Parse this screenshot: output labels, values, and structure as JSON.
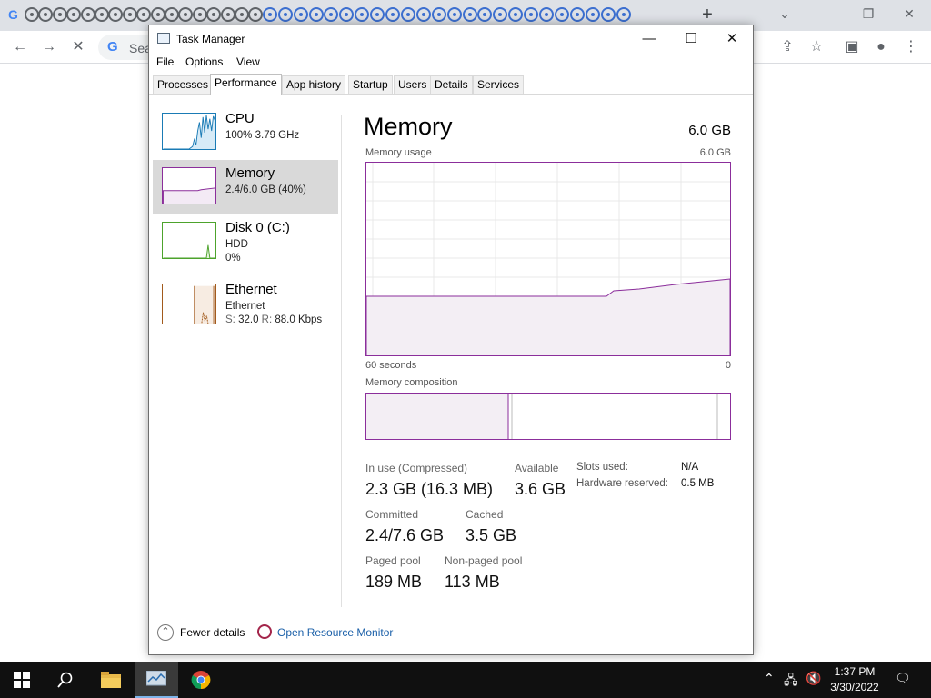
{
  "browser": {
    "omnibox_text": "Sea",
    "new_tab": "+",
    "window_controls": [
      "chevron-down",
      "minimize",
      "restore",
      "close"
    ]
  },
  "task_manager": {
    "title": "Task Manager",
    "window_controls": {
      "minimize": "—",
      "maximize": "☐",
      "close": "✕"
    },
    "menu": [
      "File",
      "Options",
      "View"
    ],
    "tabs": [
      "Processes",
      "Performance",
      "App history",
      "Startup",
      "Users",
      "Details",
      "Services"
    ],
    "active_tab": "Performance",
    "sidebar": [
      {
        "name": "CPU",
        "line1": "100%  3.79 GHz",
        "line2": "",
        "color": "#1a7bb5"
      },
      {
        "name": "Memory",
        "line1": "2.4/6.0 GB (40%)",
        "line2": "",
        "color": "#8b2e9b"
      },
      {
        "name": "Disk 0 (C:)",
        "line1": "HDD",
        "line2": "0%",
        "color": "#4da32c"
      },
      {
        "name": "Ethernet",
        "line1": "Ethernet",
        "line2_prefix_s": "S:",
        "line2_s_value": "32.0",
        "line2_prefix_r": "R:",
        "line2_r_value": "88.0 Kbps",
        "color": "#a25a1c"
      }
    ],
    "memory": {
      "title": "Memory",
      "total": "6.0 GB",
      "usage_label": "Memory usage",
      "usage_max": "6.0 GB",
      "time_left": "60 seconds",
      "time_right": "0",
      "composition_label": "Memory composition",
      "stats": {
        "in_use_label": "In use (Compressed)",
        "in_use_value": "2.3 GB (16.3 MB)",
        "available_label": "Available",
        "available_value": "3.6 GB",
        "committed_label": "Committed",
        "committed_value": "2.4/7.6 GB",
        "cached_label": "Cached",
        "cached_value": "3.5 GB",
        "paged_label": "Paged pool",
        "paged_value": "189 MB",
        "nonpaged_label": "Non-paged pool",
        "nonpaged_value": "113 MB",
        "slots_label": "Slots used:",
        "slots_value": "N/A",
        "hw_label": "Hardware reserved:",
        "hw_value": "0.5 MB"
      }
    },
    "footer": {
      "fewer_details": "Fewer details",
      "open_resource_monitor": "Open Resource Monitor"
    }
  },
  "taskbar": {
    "time": "1:37 PM",
    "date": "3/30/2022"
  }
}
